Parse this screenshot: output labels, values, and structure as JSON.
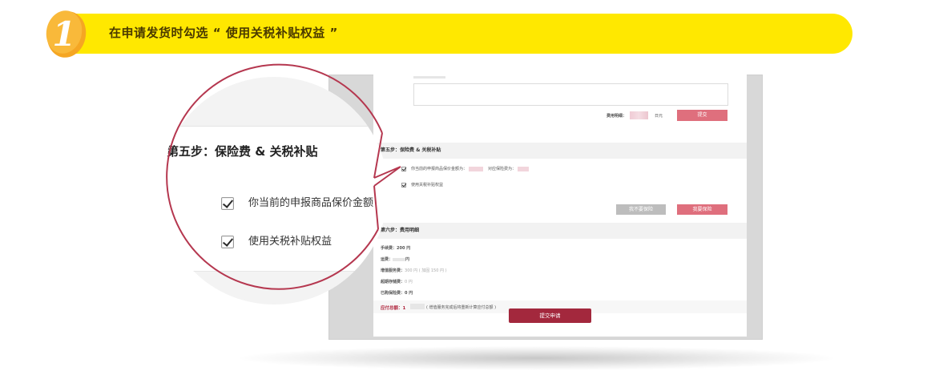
{
  "banner": {
    "step_number": "1",
    "text": "在申请发货时勾选 “ 使用关税补贴权益 ”"
  },
  "colors": {
    "banner_yellow": "#ffe800",
    "badge_orange": "#f5a623",
    "accent_red": "#a3283d",
    "button_pink": "#df6f7d",
    "magnifier_ring": "#b5374f"
  },
  "form": {
    "fee_label": "费用明细：",
    "fee_unit": "日元",
    "submit_small": "提交",
    "step5_title": "第五步：保险费 & 关税补贴",
    "insurance_row": "你当前的申报商品保价金额为：",
    "insurance_fee": "对应保险费为：",
    "tariff_row": "使用关税补贴权益",
    "btn_no_insurance": "我不要保险",
    "btn_want_insurance": "我要保险",
    "step6_title": "第六步：费用明细",
    "fees": [
      {
        "label": "手续费：",
        "value": "200 円"
      },
      {
        "label": "运费：",
        "value": "円"
      },
      {
        "label": "增值服务费：",
        "value": "300 円 ( 加固 150 円 )"
      },
      {
        "label": "超期存储费：",
        "value": "0 円"
      },
      {
        "label": "已购保险费：",
        "value": "0 円"
      }
    ],
    "total_label": "应付总额：",
    "total_prefix": "1",
    "total_note": "( 增值服务完成后将重新计算应付总额 )",
    "submit_big": "提交申请"
  },
  "magnifier": {
    "section_title": "第五步：保险费 & 关税补贴",
    "row1": "你当前的申报商品保价金额",
    "row2": "使用关税补贴权益"
  }
}
